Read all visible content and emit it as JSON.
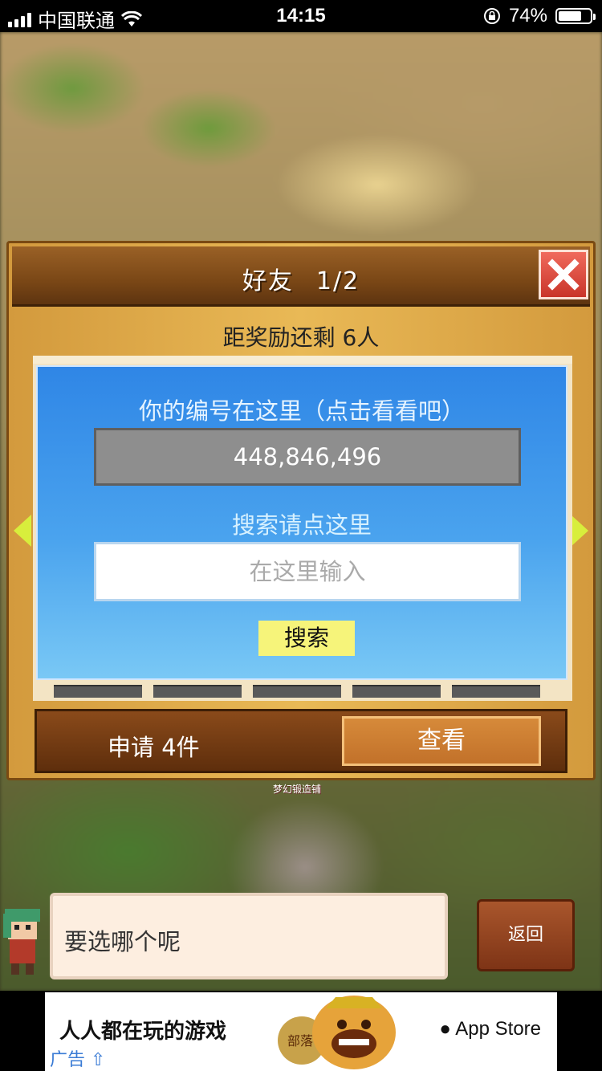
{
  "status_bar": {
    "carrier": "中国联通",
    "time": "14:15",
    "battery_percent": "74%",
    "battery_level": 0.74
  },
  "dialog": {
    "title": "好友",
    "page": "1/2",
    "reward_text": "距奖励还剩 6人",
    "id_label": "你的编号在这里（点击看看吧）",
    "id_value": "448,846,496",
    "search_label": "搜索请点这里",
    "search_placeholder": "在这里输入",
    "search_button": "搜索",
    "apply_text": "申请 4件",
    "view_button": "查看"
  },
  "place_label": "梦幻锻造铺",
  "speech": {
    "text": "要选哪个呢",
    "back_button": "返回"
  },
  "ad": {
    "title": "人人都在玩的游戏",
    "tag": "广告",
    "store": "App Store",
    "game_logo_text": "部落"
  },
  "colors": {
    "panel_blue": "#3a93ea",
    "close_red": "#d9463a",
    "search_yellow": "#f6f47a",
    "arrow_green": "#d8ee3c"
  }
}
